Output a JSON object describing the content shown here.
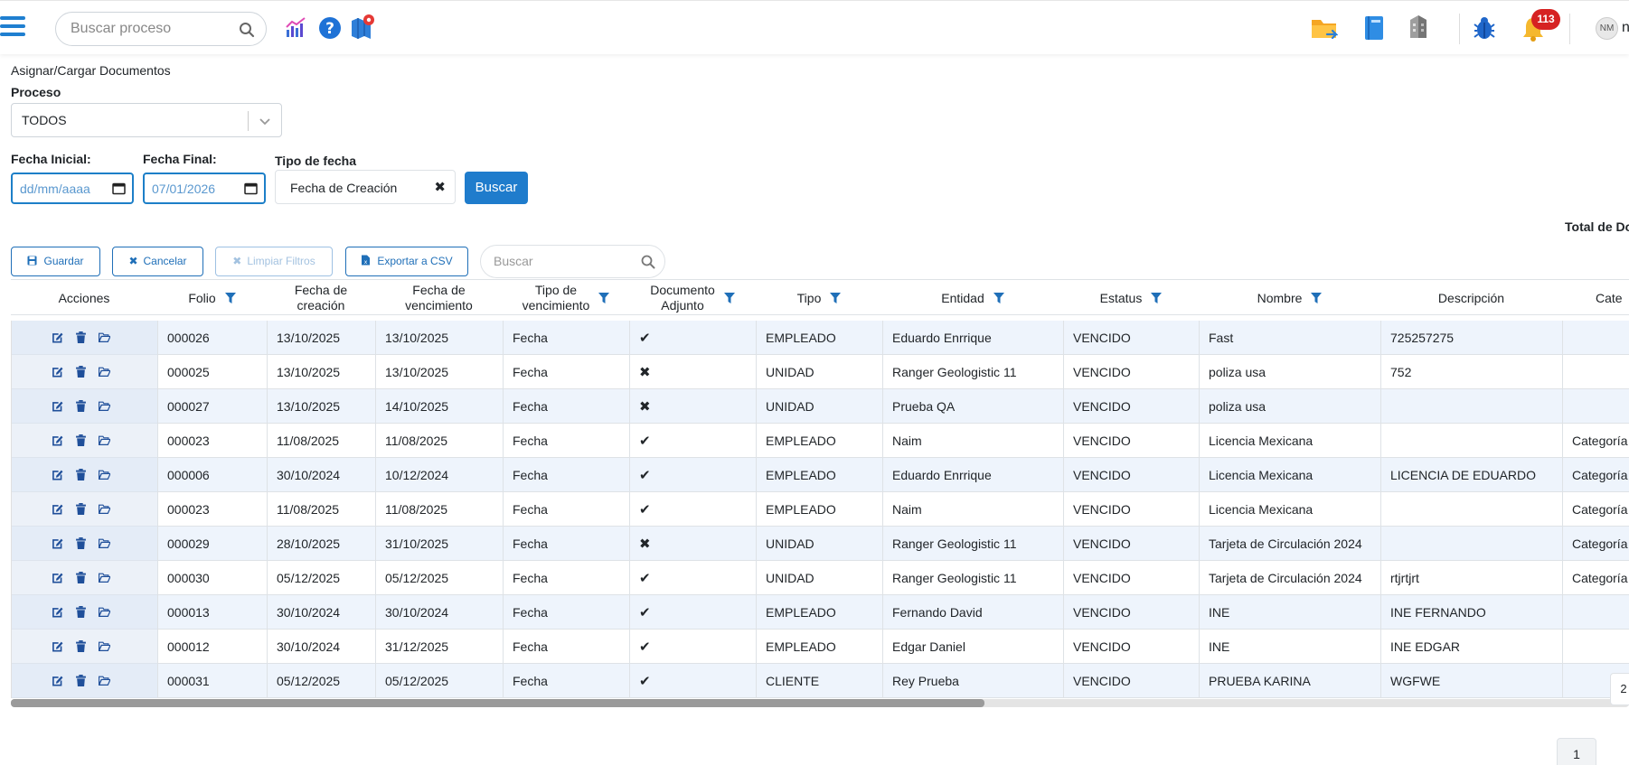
{
  "topbar": {
    "search_placeholder": "Buscar proceso",
    "notifications_count": "113",
    "avatar_initials": "NM",
    "username": "n",
    "icons": [
      "menu-icon",
      "search-icon",
      "chart-icon",
      "help-icon",
      "map-pin-icon",
      "folder-icon",
      "book-icon",
      "building-icon",
      "bug-icon",
      "bell-icon"
    ]
  },
  "breadcrumb": "Asignar/Cargar Documentos",
  "filters": {
    "proceso_label": "Proceso",
    "proceso_value": "TODOS",
    "fecha_inicial_label": "Fecha Inicial:",
    "fecha_inicial_value": "dd/mm/aaaa",
    "fecha_final_label": "Fecha Final:",
    "fecha_final_value": "07/01/2026",
    "tipo_fecha_label": "Tipo de fecha",
    "tipo_fecha_value": "Fecha de Creación",
    "clear_symbol": "✖",
    "buscar_label": "Buscar"
  },
  "total_label": "Total de Do",
  "toolbar": {
    "guardar": "Guardar",
    "cancelar": "Cancelar",
    "limpiar": "Limpiar Filtros",
    "exportar": "Exportar a CSV",
    "search_placeholder": "Buscar"
  },
  "table": {
    "columns": [
      "Acciones",
      "Folio",
      "Fecha de\ncreación",
      "Fecha de\nvencimiento",
      "Tipo de\nvencimiento",
      "Documento\nAdjunto",
      "Tipo",
      "Entidad",
      "Estatus",
      "Nombre",
      "Descripción",
      "Cate"
    ],
    "rows": [
      {
        "folio": "000026",
        "creacion": "13/10/2025",
        "vencimiento": "13/10/2025",
        "tipo_venc": "Fecha",
        "adjunto": "✔",
        "tipo": "EMPLEADO",
        "entidad": "Eduardo Enrrique",
        "estatus": "VENCIDO",
        "nombre": "Fast",
        "descripcion": "725257275",
        "categoria": ""
      },
      {
        "folio": "000025",
        "creacion": "13/10/2025",
        "vencimiento": "13/10/2025",
        "tipo_venc": "Fecha",
        "adjunto": "✖",
        "tipo": "UNIDAD",
        "entidad": "Ranger Geologistic 11",
        "estatus": "VENCIDO",
        "nombre": "poliza usa",
        "descripcion": "752",
        "categoria": ""
      },
      {
        "folio": "000027",
        "creacion": "13/10/2025",
        "vencimiento": "14/10/2025",
        "tipo_venc": "Fecha",
        "adjunto": "✖",
        "tipo": "UNIDAD",
        "entidad": "Prueba QA",
        "estatus": "VENCIDO",
        "nombre": "poliza usa",
        "descripcion": "",
        "categoria": ""
      },
      {
        "folio": "000023",
        "creacion": "11/08/2025",
        "vencimiento": "11/08/2025",
        "tipo_venc": "Fecha",
        "adjunto": "✔",
        "tipo": "EMPLEADO",
        "entidad": "Naim",
        "estatus": "VENCIDO",
        "nombre": "Licencia Mexicana",
        "descripcion": "",
        "categoria": "Categoría"
      },
      {
        "folio": "000006",
        "creacion": "30/10/2024",
        "vencimiento": "10/12/2024",
        "tipo_venc": "Fecha",
        "adjunto": "✔",
        "tipo": "EMPLEADO",
        "entidad": "Eduardo Enrrique",
        "estatus": "VENCIDO",
        "nombre": "Licencia Mexicana",
        "descripcion": "LICENCIA DE EDUARDO",
        "categoria": "Categoría"
      },
      {
        "folio": "000023",
        "creacion": "11/08/2025",
        "vencimiento": "11/08/2025",
        "tipo_venc": "Fecha",
        "adjunto": "✔",
        "tipo": "EMPLEADO",
        "entidad": "Naim",
        "estatus": "VENCIDO",
        "nombre": "Licencia Mexicana",
        "descripcion": "",
        "categoria": "Categoría"
      },
      {
        "folio": "000029",
        "creacion": "28/10/2025",
        "vencimiento": "31/10/2025",
        "tipo_venc": "Fecha",
        "adjunto": "✖",
        "tipo": "UNIDAD",
        "entidad": "Ranger Geologistic 11",
        "estatus": "VENCIDO",
        "nombre": "Tarjeta de Circulación 2024",
        "descripcion": "",
        "categoria": "Categoría"
      },
      {
        "folio": "000030",
        "creacion": "05/12/2025",
        "vencimiento": "05/12/2025",
        "tipo_venc": "Fecha",
        "adjunto": "✔",
        "tipo": "UNIDAD",
        "entidad": "Ranger Geologistic 11",
        "estatus": "VENCIDO",
        "nombre": "Tarjeta de Circulación 2024",
        "descripcion": "rtjrtjrt",
        "categoria": "Categoría"
      },
      {
        "folio": "000013",
        "creacion": "30/10/2024",
        "vencimiento": "30/10/2024",
        "tipo_venc": "Fecha",
        "adjunto": "✔",
        "tipo": "EMPLEADO",
        "entidad": "Fernando David",
        "estatus": "VENCIDO",
        "nombre": "INE",
        "descripcion": "INE FERNANDO",
        "categoria": ""
      },
      {
        "folio": "000012",
        "creacion": "30/10/2024",
        "vencimiento": "31/12/2025",
        "tipo_venc": "Fecha",
        "adjunto": "✔",
        "tipo": "EMPLEADO",
        "entidad": "Edgar Daniel",
        "estatus": "VENCIDO",
        "nombre": "INE",
        "descripcion": "INE EDGAR",
        "categoria": ""
      },
      {
        "folio": "000031",
        "creacion": "05/12/2025",
        "vencimiento": "05/12/2025",
        "tipo_venc": "Fecha",
        "adjunto": "✔",
        "tipo": "CLIENTE",
        "entidad": "Rey Prueba",
        "estatus": "VENCIDO",
        "nombre": "PRUEBA KARINA",
        "descripcion": "WGFWE",
        "categoria": ""
      }
    ]
  },
  "side_tab": "2",
  "pagination": {
    "current": "1"
  },
  "colors": {
    "primary": "#1f7ccc",
    "accent_blue": "#1d7fc8",
    "badge_red": "#d62222",
    "row_alt": "#eef4fc"
  }
}
